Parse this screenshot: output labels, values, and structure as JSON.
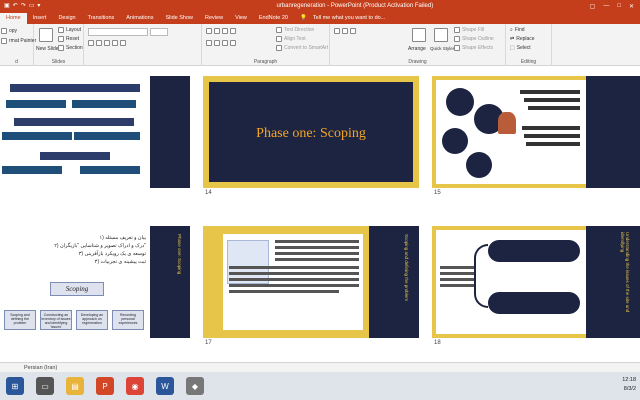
{
  "window": {
    "title": "urbanregeneration - PowerPoint (Product Activation Failed)"
  },
  "tabs": [
    {
      "label": "Home",
      "active": true
    },
    {
      "label": "Insert"
    },
    {
      "label": "Design"
    },
    {
      "label": "Transitions"
    },
    {
      "label": "Animations"
    },
    {
      "label": "Slide Show"
    },
    {
      "label": "Review"
    },
    {
      "label": "View"
    },
    {
      "label": "EndNote 20"
    }
  ],
  "tell_me": "Tell me what you want to do...",
  "ribbon": {
    "clipboard": {
      "paste": "Paste",
      "copy": "opy",
      "format_painter": "rmat Painter",
      "label": "d"
    },
    "slides": {
      "new_slide": "New Slide",
      "layout": "Layout",
      "reset": "Reset",
      "section": "Section",
      "label": "Slides"
    },
    "paragraph": {
      "text_direction": "Text Direction",
      "align_text": "Align Text",
      "smartart": "Convert to SmartArt",
      "label": "Paragraph"
    },
    "drawing": {
      "arrange": "Arrange",
      "quick_styles": "Quick Styles",
      "shape_fill": "Shape Fill",
      "shape_outline": "Shape Outline",
      "shape_effects": "Shape Effects",
      "label": "Drawing"
    },
    "editing": {
      "find": "Find",
      "replace": "Replace",
      "select": "Select",
      "label": "Editing"
    }
  },
  "slides": {
    "s14": {
      "num": "14",
      "title": "Phase one: Scoping"
    },
    "s15": {
      "num": "15"
    },
    "s16_title": "Scoping",
    "s16_vertical": "Phase one: Scoping",
    "s16_num": "",
    "s16_boxes": [
      "Scoping and defining the problem",
      "Constructing an inventory of issues and identifying 'issues'",
      "Developing an approach on regeneration",
      "Recording personal experiences"
    ],
    "s16_lines": [
      "۱) بیان و تعریف مسئله",
      "۲) درک و ادراک تصویر و شناسایی \"بازیگران\"",
      "۳) توسعه ی یک رویکرد بازآفرینی",
      "۴) ثبت پیشینه ی تجربیات"
    ],
    "s17": {
      "num": "17"
    },
    "s17_vertical": "Scoping and defining the problem",
    "s18": {
      "num": "18"
    },
    "s18_vertical": "Understanding the issues of the site and identifying"
  },
  "statusbar": {
    "language": "Persian (Iran)"
  },
  "taskbar": {
    "time": "12:18",
    "date": "8/3/2"
  },
  "colors": {
    "accent": "#c43e1c",
    "slide_yellow": "#e7c548",
    "slide_navy": "#1c2441",
    "title_orange": "#f5a623"
  }
}
